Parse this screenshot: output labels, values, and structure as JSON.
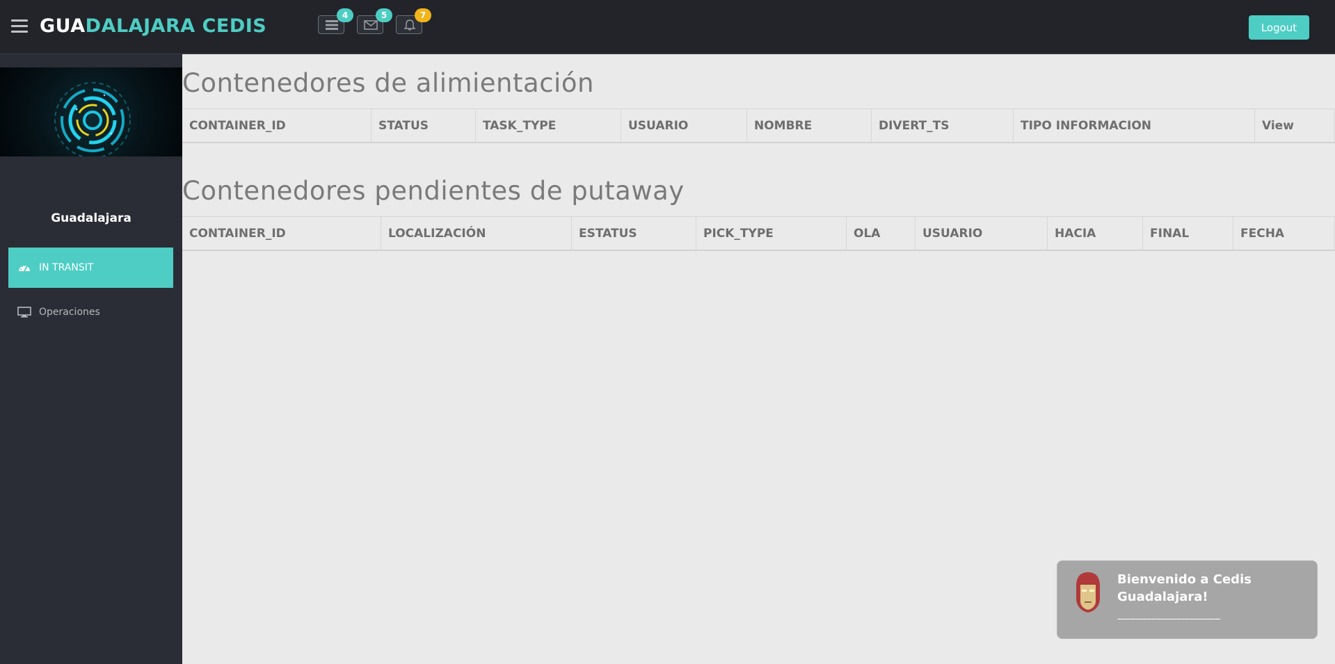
{
  "header": {
    "brand_white": "GUA",
    "brand_teal": "DALAJARA CEDIS",
    "icons": [
      {
        "name": "tasks-icon",
        "badge": "4",
        "badge_color": "#4ecdc4"
      },
      {
        "name": "envelope-icon",
        "badge": "5",
        "badge_color": "#4ecdc4"
      },
      {
        "name": "bell-icon",
        "badge": "7",
        "badge_color": "#f2b31b"
      }
    ],
    "logout_label": "Logout"
  },
  "sidebar": {
    "username": "Guadalajara",
    "items": [
      {
        "label": "IN TRANSIT",
        "icon": "dashboard-icon",
        "active": true
      },
      {
        "label": "Operaciones",
        "icon": "desktop-icon",
        "active": false
      }
    ]
  },
  "main": {
    "sections": [
      {
        "title": "Contenedores de alimientación",
        "columns": [
          "CONTAINER_ID",
          "STATUS",
          "TASK_TYPE",
          "USUARIO",
          "NOMBRE",
          "DIVERT_TS",
          "TIPO INFORMACION",
          "View"
        ]
      },
      {
        "title": "Contenedores pendientes de putaway",
        "columns": [
          "CONTAINER_ID",
          "LOCALIZACIÓN",
          "ESTATUS",
          "PICK_TYPE",
          "OLA",
          "USUARIO",
          "HACIA",
          "FINAL",
          "FECHA"
        ]
      }
    ]
  },
  "toast": {
    "message": "Bienvenido a Cedis Guadalajara!",
    "separator": "----------------------------------------"
  },
  "colors": {
    "accent": "#4ecdc4",
    "header_bg": "#22242a",
    "sidebar_bg": "#2a2d35",
    "warning": "#f2b31b"
  }
}
